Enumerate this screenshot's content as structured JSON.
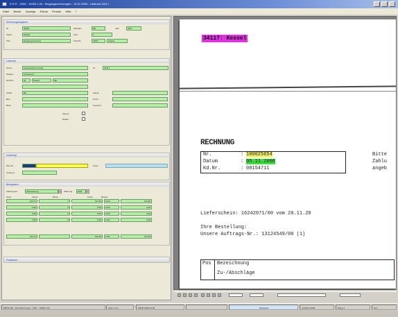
{
  "window": {
    "title": "E.R.P. - 2006 - 10000.1.00 - Eingangsrechnungen - 10.01.2006 - Lieferant 34117",
    "menu": [
      "Datei",
      "Bearb.",
      "Anzeige",
      "Extras",
      "Fenster",
      "Hilfe",
      "?"
    ]
  },
  "left": {
    "section1": {
      "title": "Rechnungsangaben",
      "lbl_id": "ID",
      "id": "38264",
      "lbl_mandant": "Mandant",
      "mandant": "DE",
      "lbl_jahr": "Jahr",
      "jahr": "2007",
      "lbl_status": "Status",
      "status": "Erfasst",
      "lbl_titel": "Titel",
      "titel": "Eingangsrechnung",
      "lbl_fest": "Kurs",
      "fest": "1",
      "lbl_plz": "PLZ/Ort",
      "plz": "33617",
      "ort": "Kassel"
    },
    "section2": {
      "title": "Lieferant",
      "lbl_name": "Name",
      "name": "Kundendienst Kessel",
      "lbl_nr": "Nr.",
      "nr": "34117",
      "lbl_strasse": "Strasse",
      "strasse": "Industriestr.",
      "lbl_plzort": "PLZ/Ort",
      "plz": "34",
      "ort": "Kassel",
      "land": "DE",
      "lbl_ustid": "UStID",
      "ustid": "DE",
      "lbl_blz": "BLZ",
      "blz": "",
      "lbl_bank": "Bank",
      "bank": "",
      "lbl_v1": "Valuta",
      "lbl_v2": "Konto",
      "lbl_v3": "Kontoinh.",
      "v1": "",
      "v2": "",
      "v3": "",
      "chk1": "Skonto",
      "chk2": "Rabatt"
    },
    "section3": {
      "title": "Vorbelegt",
      "lbl_fibu": "Fibu-Nr.",
      "fibu": "",
      "lbl_konto": "Konto",
      "konto": "",
      "lbl_kost": "Kostenst.",
      "kost": ""
    },
    "section4": {
      "title": "Belegdaten",
      "lbl_zahl": "Zahlungsart",
      "zahl": "Überweisung",
      "lbl_waehr": "Währung",
      "waehr": "EUR",
      "col_netto": "Netto",
      "col_mwst": "Steuer",
      "col_brutto": "Brutto",
      "col_konto": "Konto",
      "col_betrag": "Betrag",
      "rows": [
        [
          "123,71",
          "7",
          "131,55",
          "1234",
          "131,55"
        ],
        [
          "0,00",
          "0",
          "0,00",
          "1234",
          "0,00"
        ],
        [
          "0,00",
          "0",
          "0,00",
          "1234",
          "0,00"
        ],
        [
          "0,00",
          "0",
          "0,00",
          "1234",
          "0,00"
        ]
      ],
      "total": [
        "123,71",
        "",
        "131,55",
        "1234",
        "131,55"
      ]
    },
    "collapsed": "Positionen"
  },
  "doc": {
    "stamp": "34117: Kessel",
    "rechnung": "RECHNUNG",
    "nr_label": "Nr.",
    "nr_value": "100025654",
    "datum_label": "Datum",
    "datum_value": "05.11.2006",
    "kd_label": "Kd.Nr.",
    "kd_value": "08154711",
    "side1": "Bitte",
    "side2": "Zahlu",
    "side3": "angeb",
    "lieferschein": "Lieferschein: 16242071/00 vom 20.11.20",
    "bestell1": "Ihre Bestellung:",
    "bestell2": "Unsere Auftrags-Nr.: 13124549/00 (1)",
    "pos": "Pos",
    "bez1": "Bezeichnung",
    "bez2": "Zu-/Abschläge"
  },
  "statusbar": {
    "s1": "DBVB 200 - Alle Rechnungen - 2007 - 10000.1.00",
    "s2": "Seite 1 von",
    "s3": "DBVB.2006-10.00",
    "s4": "Belegsatz",
    "s5": "Lieferant 2006",
    "s6": "Beleg 1",
    "s7": "Neu"
  }
}
